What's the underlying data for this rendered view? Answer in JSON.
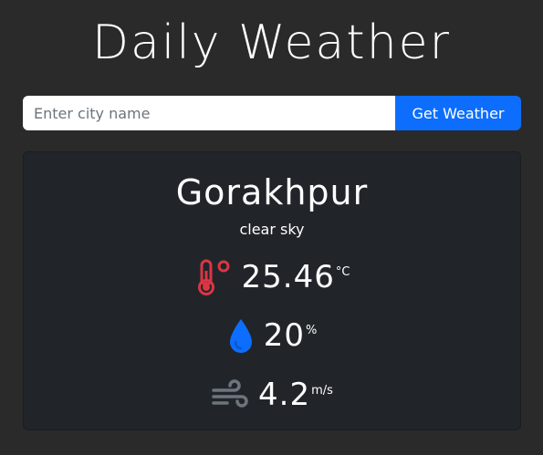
{
  "app": {
    "title": "Daily Weather"
  },
  "search": {
    "placeholder": "Enter city name",
    "value": "",
    "button_label": "Get Weather"
  },
  "weather": {
    "city": "Gorakhpur",
    "description": "clear sky",
    "temperature": {
      "value": "25.46",
      "unit": "°C",
      "icon": "thermometer-icon"
    },
    "humidity": {
      "value": "20",
      "unit": "%",
      "icon": "droplet-icon"
    },
    "wind": {
      "value": "4.2",
      "unit": "m/s",
      "icon": "wind-icon"
    }
  },
  "colors": {
    "background": "#2a2a2a",
    "card": "#212529",
    "accent_button": "#0d6efd",
    "thermometer": "#dc3545",
    "droplet": "#0d6efd",
    "wind": "#6c757d"
  }
}
